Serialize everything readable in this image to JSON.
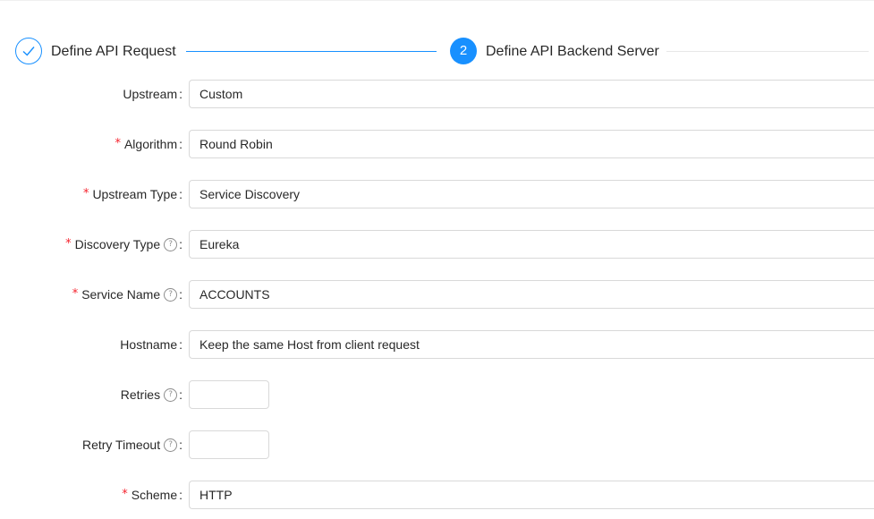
{
  "steps": [
    {
      "title": "Define API Request",
      "status": "finished",
      "icon": "check-icon"
    },
    {
      "number": "2",
      "title": "Define API Backend Server",
      "status": "active"
    }
  ],
  "form": {
    "upstream": {
      "label": "Upstream",
      "value": "Custom"
    },
    "algorithm": {
      "label": "Algorithm",
      "value": "Round Robin",
      "required": true
    },
    "upstream_type": {
      "label": "Upstream Type",
      "value": "Service Discovery",
      "required": true
    },
    "discovery_type": {
      "label": "Discovery Type",
      "value": "Eureka",
      "required": true,
      "help_icon": "question-circle-icon"
    },
    "service_name": {
      "label": "Service Name",
      "value": "ACCOUNTS",
      "required": true,
      "help_icon": "question-circle-icon"
    },
    "hostname": {
      "label": "Hostname",
      "value": "Keep the same Host from client request"
    },
    "retries": {
      "label": "Retries",
      "value": "",
      "help_icon": "question-circle-icon"
    },
    "retry_timeout": {
      "label": "Retry Timeout",
      "value": "",
      "help_icon": "question-circle-icon"
    },
    "scheme": {
      "label": "Scheme",
      "value": "HTTP",
      "required": true
    }
  },
  "colors": {
    "primary": "#1890ff",
    "required": "#f5222d",
    "border": "#d9d9d9"
  },
  "symbols": {
    "required_mark": "*",
    "colon": ":",
    "help_glyph": "?"
  }
}
